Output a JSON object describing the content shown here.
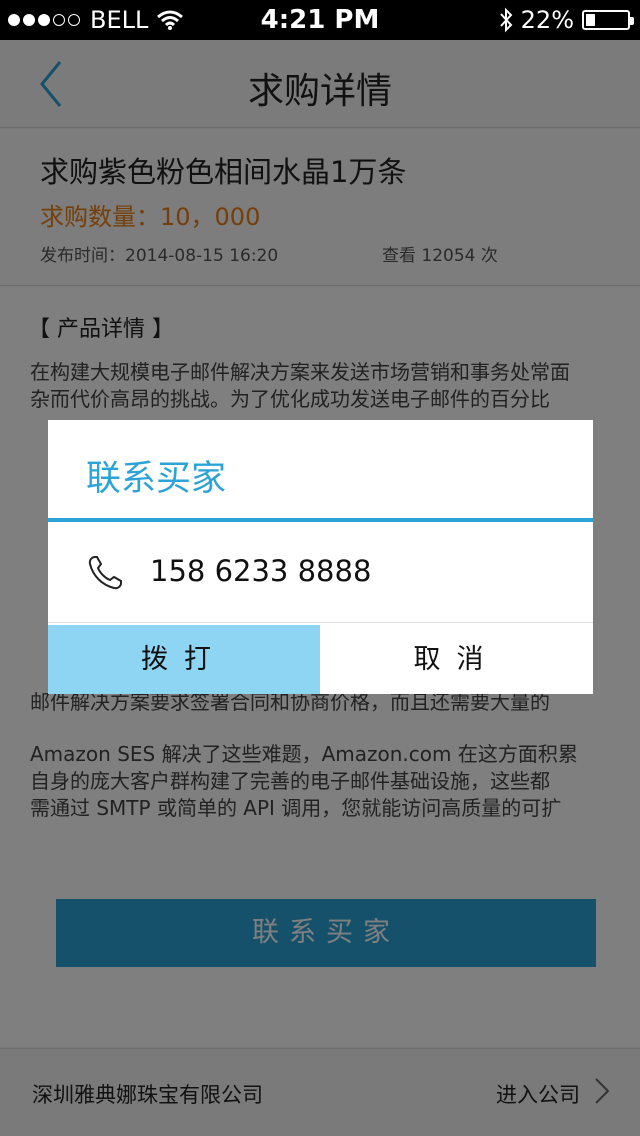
{
  "status_bar": {
    "carrier": "BELL",
    "time": "4:21 PM",
    "battery": "22%",
    "battery_level": 0.22,
    "icons": [
      "signal-dots-icon",
      "wifi-icon",
      "bluetooth-icon",
      "battery-icon"
    ]
  },
  "nav": {
    "title": "求购详情",
    "back_icon": "back-chevron-icon"
  },
  "product": {
    "name": "求购紫色粉色相间水晶1万条",
    "quantity": "求购数量：10，000",
    "publish_time": "发布时间：2014-08-15  16:20",
    "views": "查看 12054 次"
  },
  "detail": {
    "heading": "【 产品详情 】",
    "paragraphs": [
      "在构建大规模电子邮件解决方案来发送市场营销和事务处常面",
      "杂而代价高昂的挑战。为了优化成功发送电子邮件的百分比",
      "Amazon SES 解决了这些难题，Amazon.com 在这方面积累",
      "自身的庞大客户群构建了完善的电子邮件基础设施，这些都",
      "需通过 SMTP 或简单的 API 调用，您就能访问高质量的可扩"
    ],
    "line_partial": "邮件解决方案要求签署合同和协商价格，而且还需要大量的",
    "contact_button": "联系买家"
  },
  "footer": {
    "company": "深圳雅典娜珠宝有限公司",
    "enter": "进入公司"
  },
  "dialog": {
    "title": "联系买家",
    "phone": "158 6233 8888",
    "dial_button": "拨打",
    "cancel_button": "取消"
  },
  "colors": {
    "accent": "#2ca3d7",
    "dial_button_bg": "#8ed4f3",
    "quantity": "#e97e13",
    "overlay": "rgba(0,0,0,0.5)"
  }
}
